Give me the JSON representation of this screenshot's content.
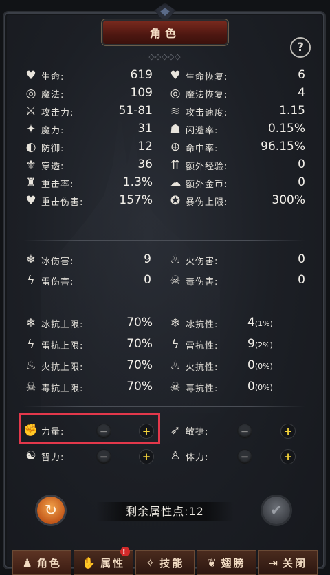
{
  "title": "角色",
  "help_label": "?",
  "stats": [
    {
      "label": "生命:",
      "value": "619",
      "icon": "heart-icon",
      "glyph": "♥"
    },
    {
      "label": "生命恢复:",
      "value": "6",
      "icon": "heart-plus-icon",
      "glyph": "♥"
    },
    {
      "label": "魔法:",
      "value": "109",
      "icon": "spiral-icon",
      "glyph": "◎"
    },
    {
      "label": "魔法恢复:",
      "value": "4",
      "icon": "spiral-plus-icon",
      "glyph": "◎"
    },
    {
      "label": "攻击力:",
      "value": "51-81",
      "icon": "sword-icon",
      "glyph": "⚔"
    },
    {
      "label": "攻击速度:",
      "value": "1.15",
      "icon": "speed-icon",
      "glyph": "≋"
    },
    {
      "label": "魔力:",
      "value": "31",
      "icon": "magic-wand-icon",
      "glyph": "✦"
    },
    {
      "label": "闪避率:",
      "value": "0.15%",
      "icon": "dodge-icon",
      "glyph": "☗"
    },
    {
      "label": "防御:",
      "value": "12",
      "icon": "shield-icon",
      "glyph": "◐"
    },
    {
      "label": "命中率:",
      "value": "96.15%",
      "icon": "crosshair-icon",
      "glyph": "⊕"
    },
    {
      "label": "穿透:",
      "value": "36",
      "icon": "pierce-icon",
      "glyph": "⚜"
    },
    {
      "label": "额外经验:",
      "value": "0",
      "icon": "exp-icon",
      "glyph": "⇈"
    },
    {
      "label": "重击率:",
      "value": "1.3%",
      "icon": "crit-rate-icon",
      "glyph": "♜"
    },
    {
      "label": "额外金币:",
      "value": "0",
      "icon": "gold-icon",
      "glyph": "☁"
    },
    {
      "label": "重击伤害:",
      "value": "157%",
      "icon": "crit-damage-icon",
      "glyph": "♥"
    },
    {
      "label": "暴伤上限:",
      "value": "300%",
      "icon": "crit-cap-icon",
      "glyph": "✪"
    }
  ],
  "damage": [
    {
      "label": "冰伤害:",
      "value": "9",
      "icon": "ice-icon",
      "glyph": "❄"
    },
    {
      "label": "火伤害:",
      "value": "0",
      "icon": "fire-icon",
      "glyph": "♨"
    },
    {
      "label": "雷伤害:",
      "value": "0",
      "icon": "lightning-icon",
      "glyph": "ϟ"
    },
    {
      "label": "毒伤害:",
      "value": "0",
      "icon": "poison-icon",
      "glyph": "☠"
    }
  ],
  "resist": [
    {
      "label": "冰抗上限:",
      "value": "70%",
      "icon": "ice-cap-icon",
      "glyph": "❄"
    },
    {
      "label": "冰抗性:",
      "value": "4",
      "pct": "(1%)",
      "icon": "ice-resist-icon",
      "glyph": "❄"
    },
    {
      "label": "雷抗上限:",
      "value": "70%",
      "icon": "lightning-cap-icon",
      "glyph": "ϟ"
    },
    {
      "label": "雷抗性:",
      "value": "9",
      "pct": "(2%)",
      "icon": "lightning-resist-icon",
      "glyph": "ϟ"
    },
    {
      "label": "火抗上限:",
      "value": "70%",
      "icon": "fire-cap-icon",
      "glyph": "♨"
    },
    {
      "label": "火抗性:",
      "value": "0",
      "pct": "(0%)",
      "icon": "fire-resist-icon",
      "glyph": "♨"
    },
    {
      "label": "毒抗上限:",
      "value": "70%",
      "icon": "poison-cap-icon",
      "glyph": "☠"
    },
    {
      "label": "毒抗性:",
      "value": "0",
      "pct": "(0%)",
      "icon": "poison-resist-icon",
      "glyph": "☠"
    }
  ],
  "attributes": [
    {
      "label": "力量:",
      "icon": "strength-icon",
      "glyph": "✊"
    },
    {
      "label": "敏捷:",
      "icon": "agility-icon",
      "glyph": "➶"
    },
    {
      "label": "智力:",
      "icon": "intellect-icon",
      "glyph": "☯"
    },
    {
      "label": "体力:",
      "icon": "stamina-icon",
      "glyph": "♙"
    }
  ],
  "remaining_points": "剩余属性点:12",
  "tabs": [
    {
      "label": "角色",
      "icon": "character-tab-icon",
      "glyph": "♟"
    },
    {
      "label": "属性",
      "icon": "attributes-tab-icon",
      "glyph": "✋",
      "badge": "!"
    },
    {
      "label": "技能",
      "icon": "skills-tab-icon",
      "glyph": "✧"
    },
    {
      "label": "翅膀",
      "icon": "wings-tab-icon",
      "glyph": "❦"
    },
    {
      "label": "关闭",
      "icon": "close-tab-icon",
      "glyph": "⇥"
    }
  ],
  "colors": {
    "accent_red": "#e3384b",
    "plus_yellow": "#f5d43a",
    "title_bg": "#5a1a12"
  }
}
